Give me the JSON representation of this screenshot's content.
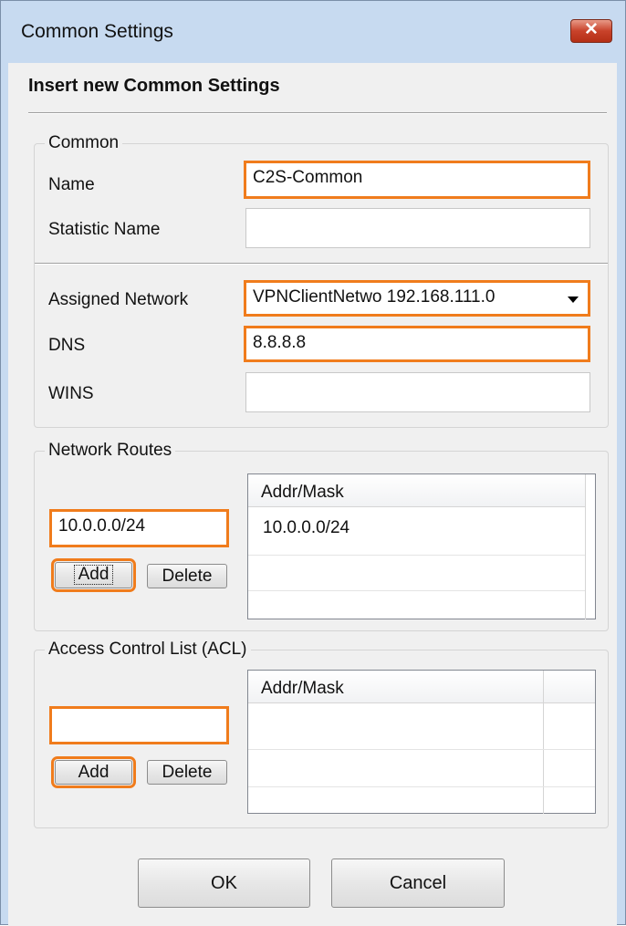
{
  "window": {
    "title": "Common Settings",
    "close_symbol": "✕"
  },
  "dialog": {
    "heading": "Insert new Common Settings"
  },
  "common_group": {
    "legend": "Common",
    "name_label": "Name",
    "name_value": "C2S-Common",
    "statistic_name_label": "Statistic Name",
    "statistic_name_value": "",
    "assigned_network_label": "Assigned Network",
    "assigned_network_value": "VPNClientNetwo 192.168.111.0",
    "dns_label": "DNS",
    "dns_value": "8.8.8.8",
    "wins_label": "WINS",
    "wins_value": ""
  },
  "network_routes": {
    "legend": "Network Routes",
    "input_value": "10.0.0.0/24",
    "add_label": "Add",
    "delete_label": "Delete",
    "column_header": "Addr/Mask",
    "rows": [
      "10.0.0.0/24"
    ]
  },
  "acl": {
    "legend": "Access Control List (ACL)",
    "input_value": "",
    "add_label": "Add",
    "delete_label": "Delete",
    "column_header": "Addr/Mask",
    "rows": []
  },
  "footer": {
    "ok_label": "OK",
    "cancel_label": "Cancel"
  },
  "colors": {
    "highlight": "#f07c1c",
    "window_frame": "#c7daf0",
    "dialog_bg": "#f0f0f0",
    "close_button": "#c8422a"
  },
  "icons": {
    "close": "close-icon",
    "dropdown": "chevron-down-icon"
  }
}
